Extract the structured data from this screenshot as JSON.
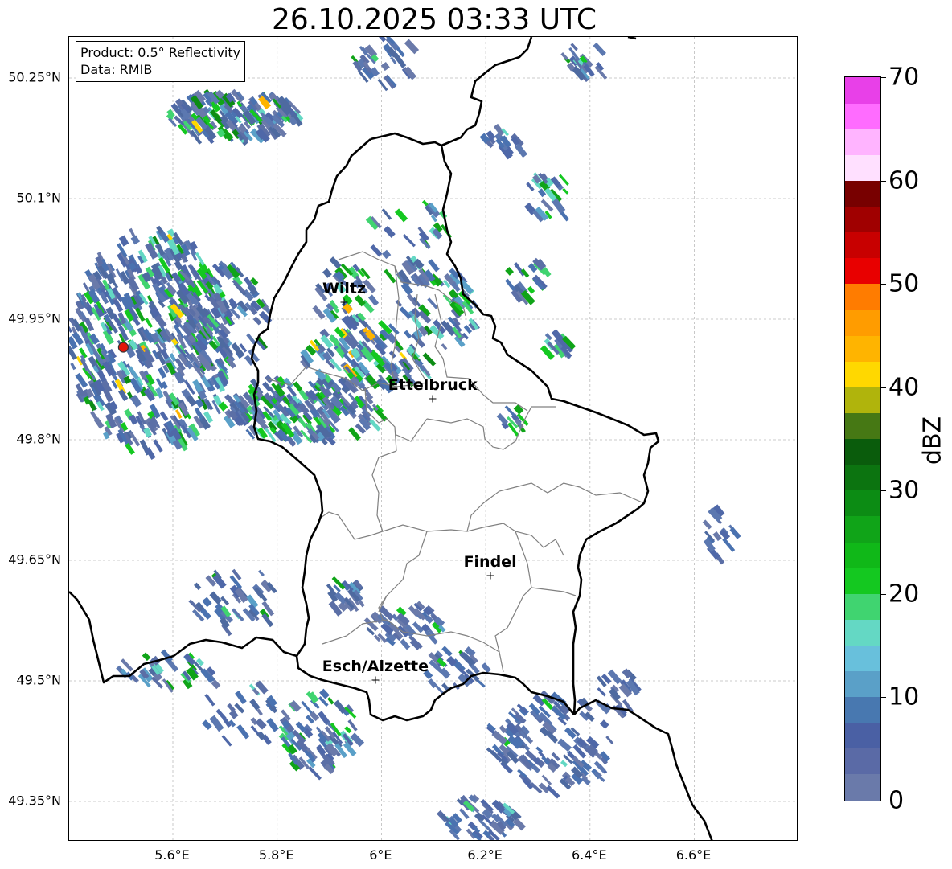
{
  "title": "26.10.2025 03:33 UTC",
  "info_box": {
    "product_line": "Product: 0.5° Reflectivity",
    "data_line": "Data: RMIB"
  },
  "map": {
    "lat_ticks": [
      {
        "lat": 50.25,
        "label": "50.25°N"
      },
      {
        "lat": 50.1,
        "label": "50.1°N"
      },
      {
        "lat": 49.95,
        "label": "49.95°N"
      },
      {
        "lat": 49.8,
        "label": "49.8°N"
      },
      {
        "lat": 49.65,
        "label": "49.65°N"
      },
      {
        "lat": 49.5,
        "label": "49.5°N"
      },
      {
        "lat": 49.35,
        "label": "49.35°N"
      }
    ],
    "lon_ticks": [
      {
        "lon": 5.6,
        "label": "5.6°E"
      },
      {
        "lon": 5.8,
        "label": "5.8°E"
      },
      {
        "lon": 6.0,
        "label": "6°E"
      },
      {
        "lon": 6.2,
        "label": "6.2°E"
      },
      {
        "lon": 6.4,
        "label": "6.4°E"
      },
      {
        "lon": 6.6,
        "label": "6.6°E"
      }
    ],
    "cities": [
      {
        "name": "Wiltz",
        "lon": 5.93,
        "lat": 49.97
      },
      {
        "name": "Ettelbruck",
        "lon": 6.1,
        "lat": 49.85
      },
      {
        "name": "Findel",
        "lon": 6.21,
        "lat": 49.63
      },
      {
        "name": "Esch/Alzette",
        "lon": 5.99,
        "lat": 49.5
      }
    ],
    "radar_site": {
      "lon": 5.505,
      "lat": 49.915,
      "color": "#e3170a"
    }
  },
  "colorbar": {
    "label": "dBZ",
    "min": 0,
    "max": 70,
    "ticks": [
      {
        "value": 0,
        "label": "0"
      },
      {
        "value": 10,
        "label": "10"
      },
      {
        "value": 20,
        "label": "20"
      },
      {
        "value": 30,
        "label": "30"
      },
      {
        "value": 40,
        "label": "40"
      },
      {
        "value": 50,
        "label": "50"
      },
      {
        "value": 60,
        "label": "60"
      },
      {
        "value": 70,
        "label": "70"
      }
    ],
    "colors": [
      "#6a7aaa",
      "#5a6aa6",
      "#4a60a4",
      "#4878b0",
      "#5aa0c8",
      "#68c0dc",
      "#64d8c4",
      "#40d470",
      "#14c820",
      "#10b818",
      "#10a418",
      "#0c8c14",
      "#0c7410",
      "#0a5c0c",
      "#467814",
      "#b0b40c",
      "#ffd800",
      "#ffb400",
      "#ff9c00",
      "#ff7c00",
      "#e80000",
      "#c80000",
      "#a00000",
      "#780000",
      "#ffe0ff",
      "#ffb4ff",
      "#ff6cff",
      "#e840e8"
    ]
  }
}
